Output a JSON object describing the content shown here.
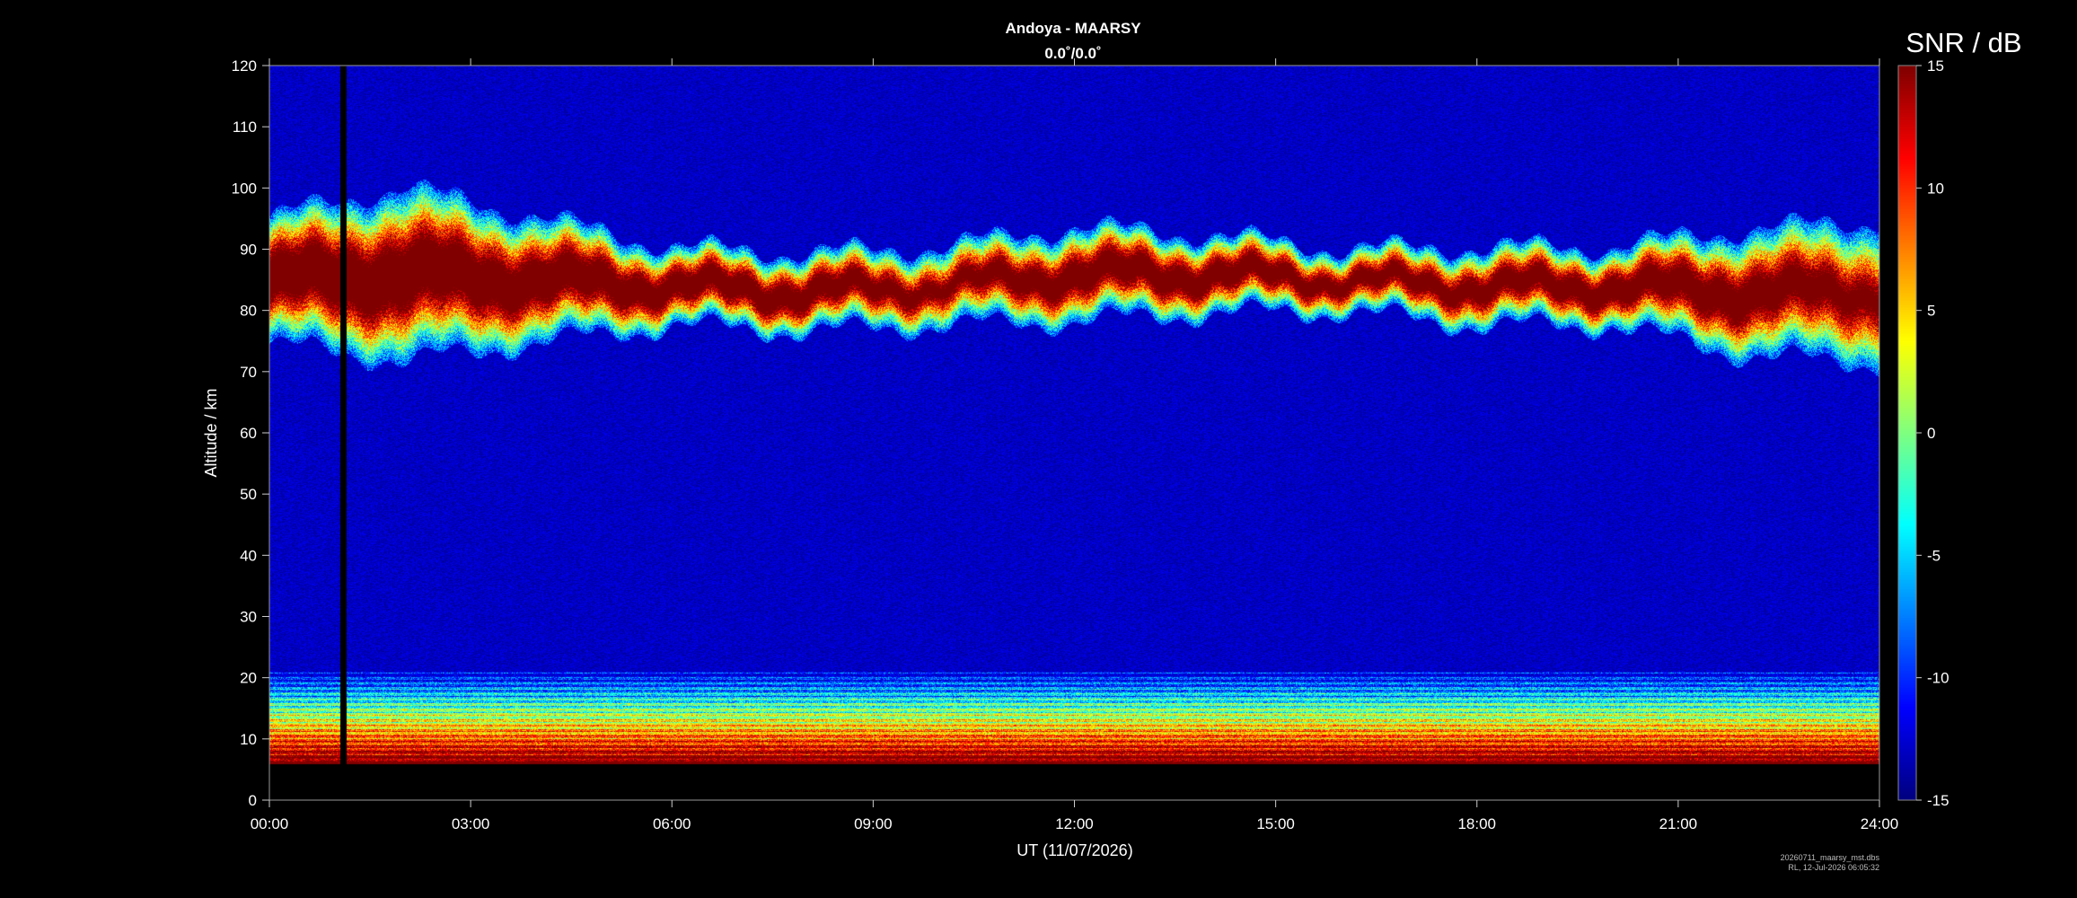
{
  "chart_data": {
    "type": "heatmap",
    "title": "Andoya - MAARSY",
    "subtitle": "0.0˚/0.0˚",
    "xlabel": "UT (11/07/2026)",
    "ylabel": "Altitude / km",
    "x_ticks": [
      "00:00",
      "03:00",
      "06:00",
      "09:00",
      "12:00",
      "15:00",
      "18:00",
      "21:00",
      "24:00"
    ],
    "x_range_hours": [
      0,
      24
    ],
    "y_ticks": [
      0,
      10,
      20,
      30,
      40,
      50,
      60,
      70,
      80,
      90,
      100,
      110,
      120
    ],
    "y_range_km": [
      0,
      120
    ],
    "colorbar": {
      "label": "SNR / dB",
      "ticks": [
        15,
        10,
        5,
        0,
        -5,
        -10,
        -15
      ],
      "range": [
        -15,
        15
      ],
      "colormap": "jet"
    },
    "features": {
      "data_gap_hours": [
        1.05,
        1.15
      ],
      "min_altitude_km": 6,
      "background_snr_db": -13,
      "mesosphere_echo_layer": [
        {
          "hour": 0.0,
          "center_km": 85,
          "thickness_km": 8,
          "peak_snr_db": 15
        },
        {
          "hour": 2.0,
          "center_km": 86,
          "thickness_km": 11,
          "peak_snr_db": 15
        },
        {
          "hour": 4.0,
          "center_km": 85,
          "thickness_km": 8,
          "peak_snr_db": 14
        },
        {
          "hour": 6.0,
          "center_km": 84,
          "thickness_km": 5,
          "peak_snr_db": 13
        },
        {
          "hour": 8.0,
          "center_km": 83,
          "thickness_km": 5,
          "peak_snr_db": 13
        },
        {
          "hour": 10.0,
          "center_km": 84,
          "thickness_km": 5,
          "peak_snr_db": 10
        },
        {
          "hour": 12.0,
          "center_km": 86,
          "thickness_km": 6,
          "peak_snr_db": 13
        },
        {
          "hour": 14.0,
          "center_km": 86,
          "thickness_km": 5,
          "peak_snr_db": 13
        },
        {
          "hour": 16.0,
          "center_km": 85,
          "thickness_km": 4,
          "peak_snr_db": 11
        },
        {
          "hour": 18.0,
          "center_km": 84,
          "thickness_km": 5,
          "peak_snr_db": 12
        },
        {
          "hour": 20.0,
          "center_km": 84,
          "thickness_km": 5,
          "peak_snr_db": 13
        },
        {
          "hour": 22.0,
          "center_km": 83,
          "thickness_km": 8,
          "peak_snr_db": 13
        },
        {
          "hour": 24.0,
          "center_km": 83,
          "thickness_km": 9,
          "peak_snr_db": 10
        }
      ],
      "troposphere_echo_top_km": 21
    },
    "footnote_lines": [
      "20260711_maarsy_mst.dbs",
      "RL, 12-Jul-2026 06:05:32"
    ]
  }
}
